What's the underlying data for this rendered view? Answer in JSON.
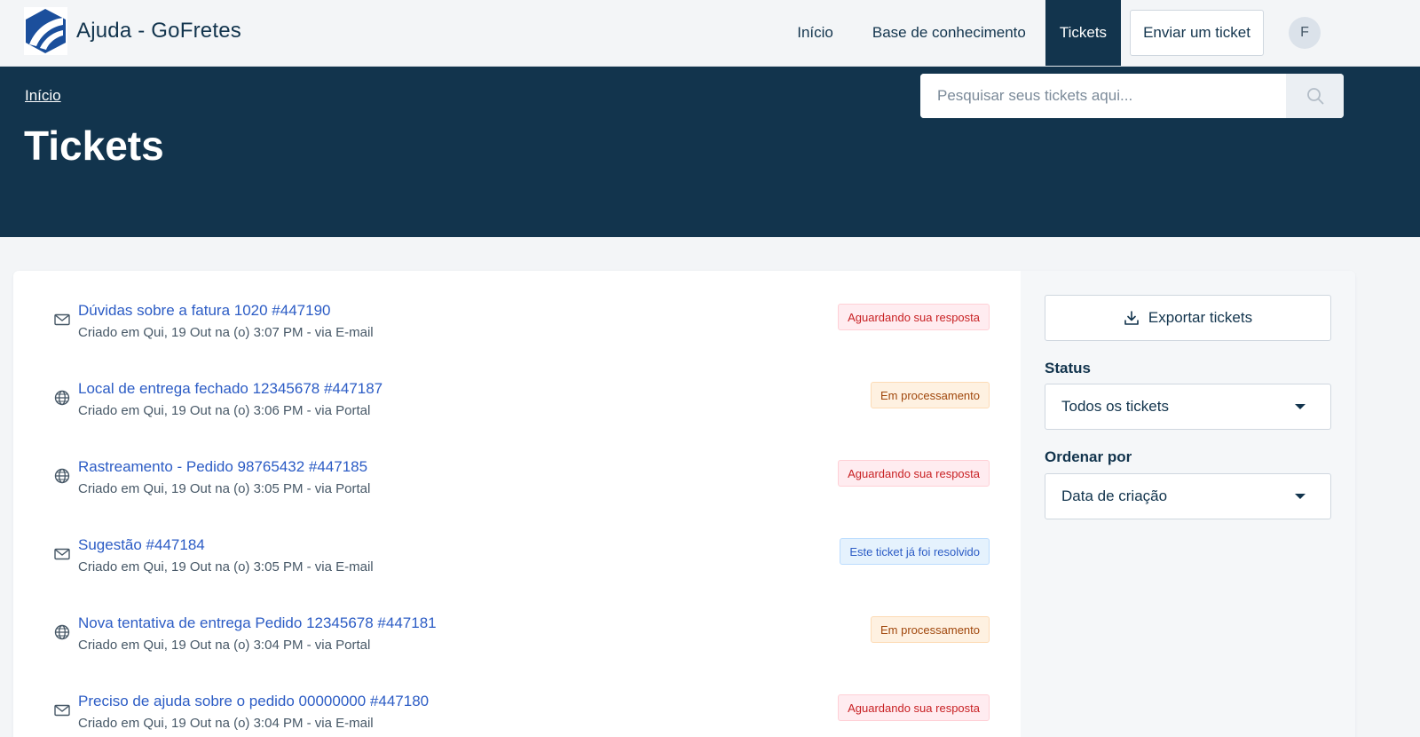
{
  "brand": {
    "title": "Ajuda - GoFretes"
  },
  "nav": {
    "home": "Início",
    "knowledge_base": "Base de conhecimento",
    "tickets": "Tickets",
    "submit_ticket": "Enviar um ticket",
    "avatar_initial": "F"
  },
  "hero": {
    "breadcrumb": "Início",
    "title": "Tickets",
    "search_placeholder": "Pesquisar seus tickets aqui..."
  },
  "tickets": [
    {
      "icon": "mail-icon",
      "title": "Dúvidas sobre a fatura 1020 #447190",
      "meta": "Criado em Qui, 19 Out na (o) 3:07 PM - via E-mail",
      "status": "Aguardando sua resposta",
      "status_type": "awaiting"
    },
    {
      "icon": "globe-icon",
      "title": "Local de entrega fechado 12345678 #447187",
      "meta": "Criado em Qui, 19 Out na (o) 3:06 PM - via Portal",
      "status": "Em processamento",
      "status_type": "processing"
    },
    {
      "icon": "globe-icon",
      "title": "Rastreamento - Pedido 98765432 #447185",
      "meta": "Criado em Qui, 19 Out na (o) 3:05 PM - via Portal",
      "status": "Aguardando sua resposta",
      "status_type": "awaiting"
    },
    {
      "icon": "mail-icon",
      "title": "Sugestão #447184",
      "meta": "Criado em Qui, 19 Out na (o) 3:05 PM - via E-mail",
      "status": "Este ticket já foi resolvido",
      "status_type": "resolved"
    },
    {
      "icon": "globe-icon",
      "title": "Nova tentativa de entrega Pedido 12345678 #447181",
      "meta": "Criado em Qui, 19 Out na (o) 3:04 PM - via Portal",
      "status": "Em processamento",
      "status_type": "processing"
    },
    {
      "icon": "mail-icon",
      "title": "Preciso de ajuda sobre o pedido 00000000 #447180",
      "meta": "Criado em Qui, 19 Out na (o) 3:04 PM - via E-mail",
      "status": "Aguardando sua resposta",
      "status_type": "awaiting"
    }
  ],
  "sidebar": {
    "export_label": "Exportar tickets",
    "status_label": "Status",
    "status_value": "Todos os tickets",
    "sort_label": "Ordenar por",
    "sort_value": "Data de criação"
  },
  "colors": {
    "primary_dark": "#12344d",
    "link": "#2c5cc5",
    "awaiting": "#c82124",
    "processing": "#a0470c",
    "resolved": "#2c5cc5"
  }
}
